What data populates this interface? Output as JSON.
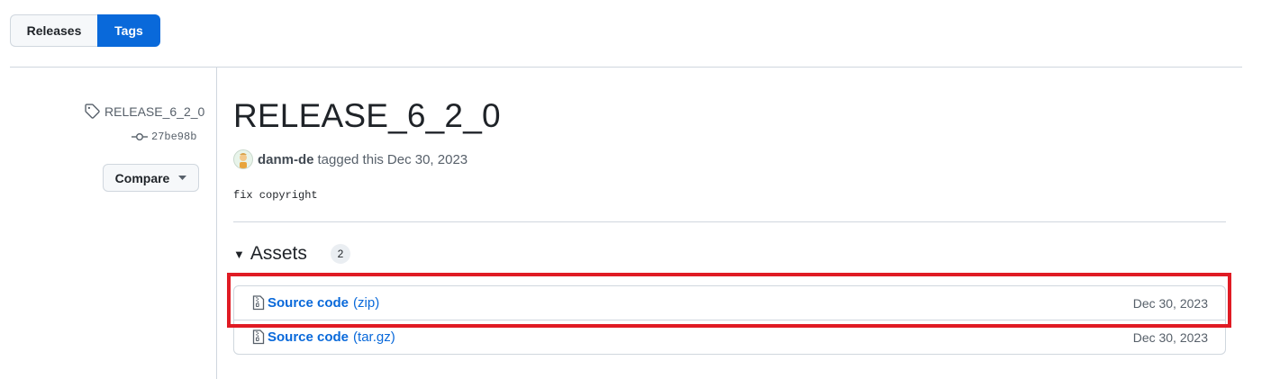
{
  "tabs": {
    "releases": "Releases",
    "tags": "Tags",
    "active": "tags"
  },
  "sidebar": {
    "tag_name": "RELEASE_6_2_0",
    "commit": "27be98b",
    "compare_label": "Compare",
    "tag_icon": "tag-icon",
    "commit_icon": "git-commit-icon",
    "chevron_icon": "triangle-down-icon"
  },
  "release": {
    "title": "RELEASE_6_2_0",
    "author": "danm-de",
    "tagged_text": "tagged this",
    "date": "Dec 30, 2023",
    "message": "fix copyright"
  },
  "assets": {
    "heading": "Assets",
    "count": "2",
    "items": [
      {
        "name": "Source code",
        "ext": "(zip)",
        "date": "Dec 30, 2023",
        "icon": "file-zip-icon",
        "highlighted": true
      },
      {
        "name": "Source code",
        "ext": "(tar.gz)",
        "date": "Dec 30, 2023",
        "icon": "file-zip-icon",
        "highlighted": false
      }
    ]
  },
  "colors": {
    "accent": "#0969da",
    "highlight": "#e01b24",
    "border": "#d0d7de",
    "muted": "#57606a"
  }
}
